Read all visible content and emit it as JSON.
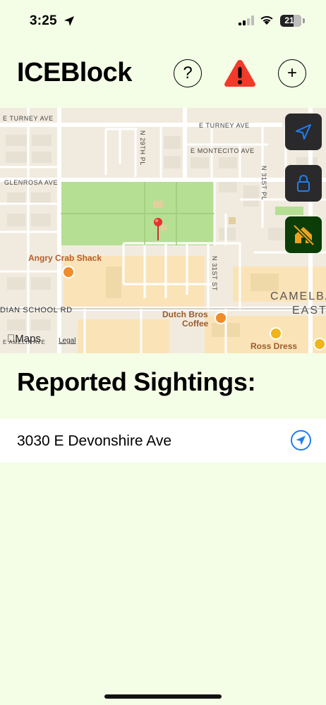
{
  "status_bar": {
    "time": "3:25",
    "battery": "21"
  },
  "header": {
    "title": "ICEBlock",
    "help_glyph": "?",
    "add_glyph": "+",
    "alert_color": "#f23a2a"
  },
  "map": {
    "streets": {
      "turney_west": "E TURNEY AVE",
      "turney_east": "E TURNEY AVE",
      "montecito": "E MONTECITO AVE",
      "glenrosa": "GLENROSA AVE",
      "n29th": "N 29TH PL",
      "n31st_pl": "N 31ST PL",
      "n31st_st": "N 31ST ST",
      "indian_school": "DIAN SCHOOL RD",
      "bottom_left": "E AMELIA AVE"
    },
    "pois": {
      "angry_crab": "Angry Crab Shack",
      "dutch_bros_1": "Dutch Bros",
      "dutch_bros_2": "Coffee",
      "ross": "Ross Dress"
    },
    "district_1": "CAMELBA",
    "district_2": "EAST",
    "attribution": "Maps",
    "legal": "Legal",
    "pin_color": "#e8322f",
    "controls": [
      {
        "name": "locate",
        "icon": "location-arrow-icon"
      },
      {
        "name": "lock",
        "icon": "lock-icon"
      },
      {
        "name": "home-slash",
        "icon": "home-slash-icon"
      }
    ]
  },
  "sightings": {
    "title": "Reported Sightings:",
    "items": [
      {
        "address": "3030 E Devonshire Ave",
        "icon": "navigate-icon"
      }
    ]
  },
  "accent_color": "#1e7ef0",
  "background_color": "#f4fde6"
}
